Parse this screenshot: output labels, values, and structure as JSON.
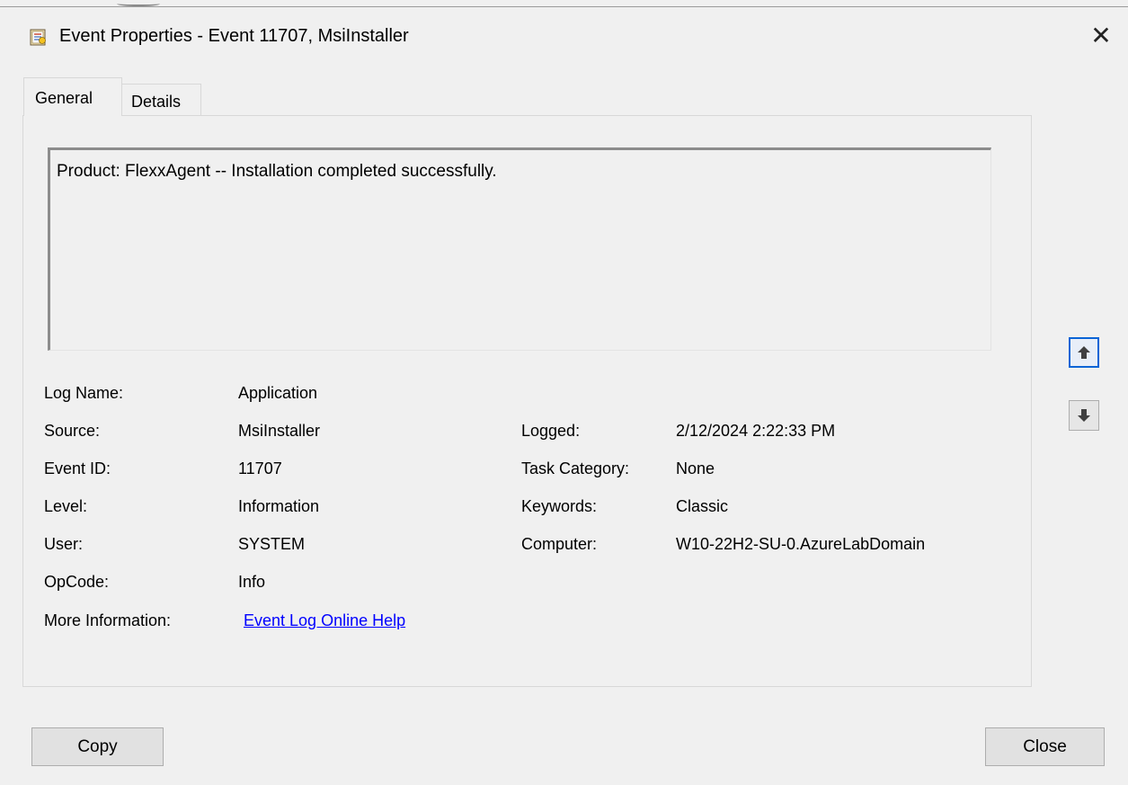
{
  "window": {
    "title": "Event Properties - Event 11707, MsiInstaller",
    "close_glyph": "✕",
    "icon": "event-properties-icon"
  },
  "tabs": [
    {
      "label": "General",
      "selected": true
    },
    {
      "label": "Details",
      "selected": false
    }
  ],
  "description": "Product: FlexxAgent -- Installation completed successfully.",
  "fields": {
    "log_name": {
      "label": "Log Name:",
      "value": "Application"
    },
    "source": {
      "label": "Source:",
      "value": "MsiInstaller"
    },
    "logged": {
      "label": "Logged:",
      "value": "2/12/2024 2:22:33 PM"
    },
    "event_id": {
      "label": "Event ID:",
      "value": "11707"
    },
    "task_category": {
      "label": "Task Category:",
      "value": "None"
    },
    "level": {
      "label": "Level:",
      "value": "Information"
    },
    "keywords": {
      "label": "Keywords:",
      "value": "Classic"
    },
    "user": {
      "label": "User:",
      "value": "SYSTEM"
    },
    "computer": {
      "label": "Computer:",
      "value": "W10-22H2-SU-0.AzureLabDomain"
    },
    "opcode": {
      "label": "OpCode:",
      "value": "Info"
    },
    "more_info": {
      "label": "More Information:",
      "link": "Event Log Online Help"
    }
  },
  "buttons": {
    "copy": "Copy",
    "close": "Close"
  },
  "nav": {
    "up_icon": "arrow-up-icon",
    "down_icon": "arrow-down-icon"
  },
  "colors": {
    "background": "#f0f0f0",
    "link": "#0000ff",
    "focus_border": "#0a64d6"
  }
}
